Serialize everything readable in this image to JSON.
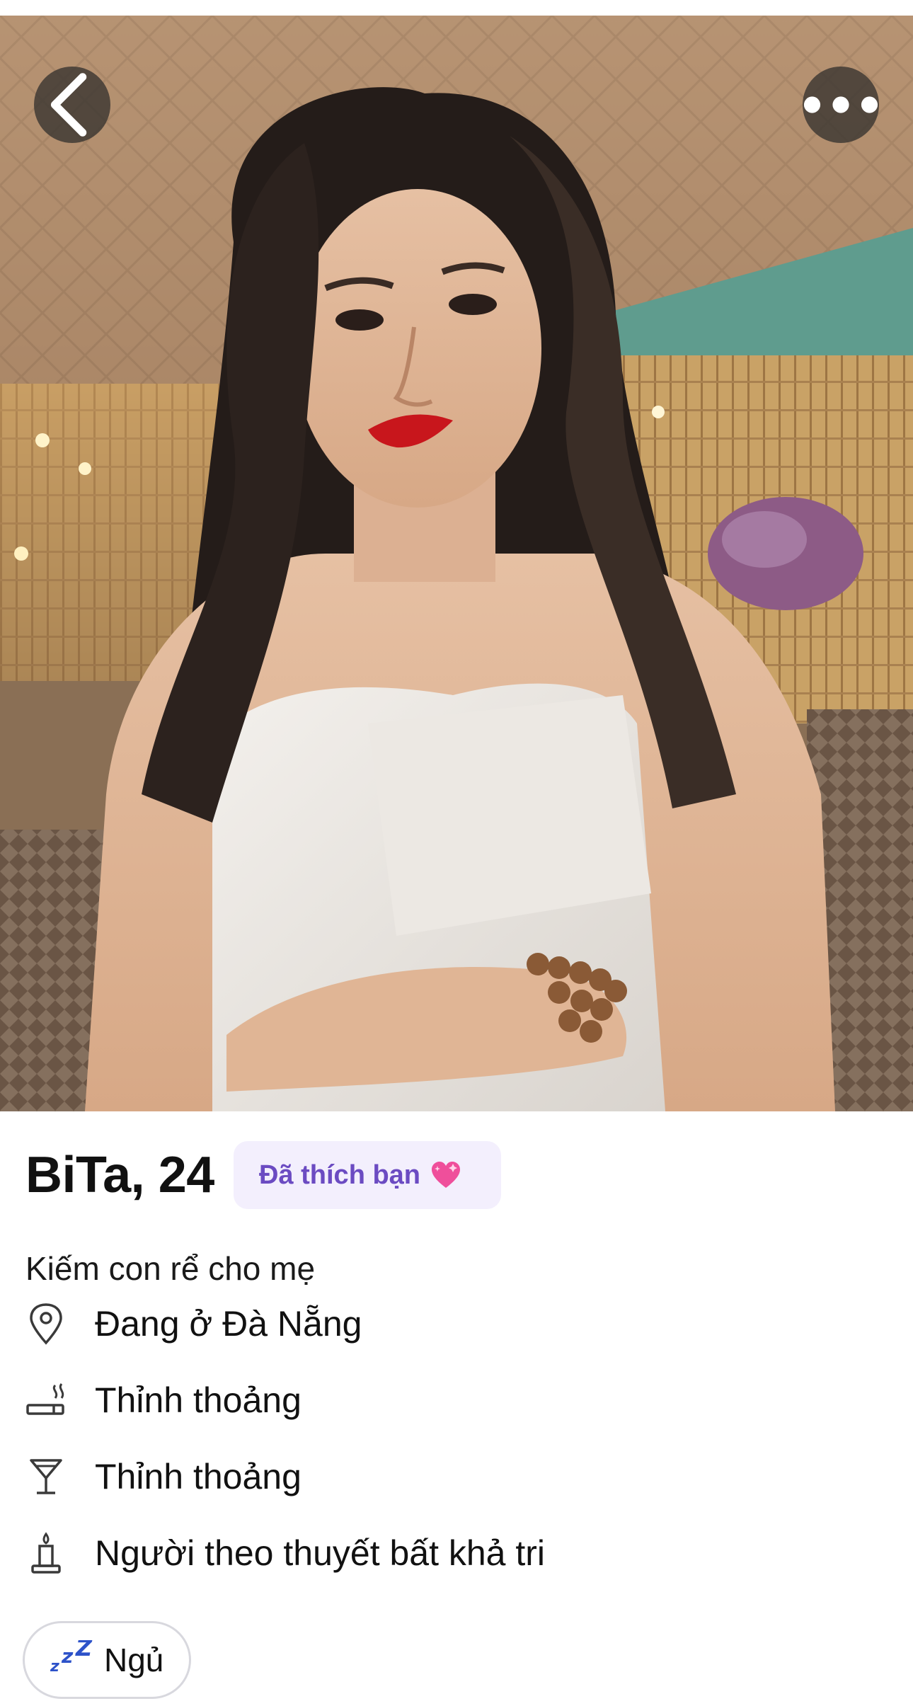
{
  "photo": {
    "description_icon": "profile-photo"
  },
  "nav": {
    "back_icon": "chevron-left-icon",
    "more_icon": "more-horizontal-icon"
  },
  "profile": {
    "name_age": "BiTa, 24",
    "liked_badge": "Đã thích bạn",
    "bio": "Kiếm con rể cho mẹ",
    "details": [
      {
        "icon": "location-pin-icon",
        "text": "Đang ở Đà Nẵng"
      },
      {
        "icon": "smoking-icon",
        "text": "Thỉnh thoảng"
      },
      {
        "icon": "cocktail-glass-icon",
        "text": "Thỉnh thoảng"
      },
      {
        "icon": "candle-icon",
        "text": "Người theo thuyết bất khả tri"
      }
    ],
    "chip": {
      "icon": "zzz-icon",
      "label": "Ngủ"
    }
  },
  "colors": {
    "badge_bg": "#f3effd",
    "badge_text": "#6b4bc2",
    "chip_icon": "#2d52c9"
  }
}
